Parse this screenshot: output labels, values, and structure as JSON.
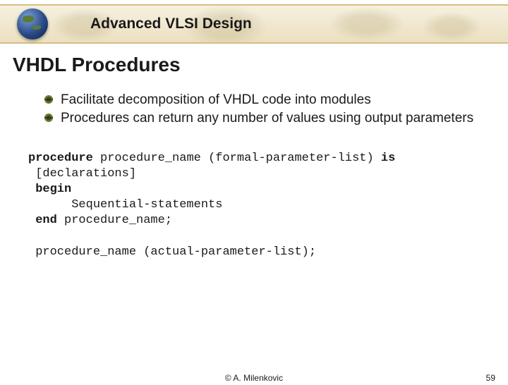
{
  "header": {
    "course_title": "Advanced VLSI Design"
  },
  "slide": {
    "title": "VHDL Procedures",
    "bullets": [
      "Facilitate decomposition of VHDL code into modules",
      "Procedures can return any number of values using output parameters"
    ]
  },
  "code": {
    "kw_procedure": "procedure",
    "proc_name": " procedure_name ",
    "formal_list": "(formal-parameter-list) ",
    "kw_is": "is",
    "declarations": " [declarations]",
    "kw_begin": " begin",
    "seq_stmts": "      Sequential-statements",
    "kw_end": " end",
    "end_name": " procedure_name;",
    "call": " procedure_name (actual-parameter-list);"
  },
  "footer": {
    "copyright": "©  A. Milenkovic",
    "page": "59"
  }
}
